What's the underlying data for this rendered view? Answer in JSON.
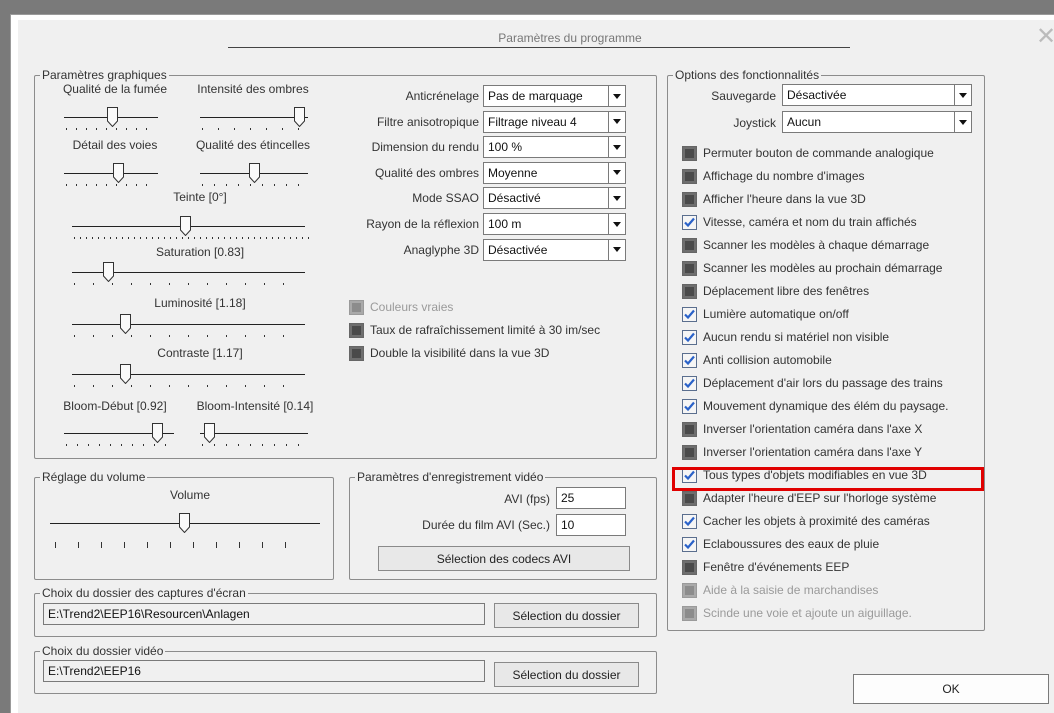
{
  "dialog": {
    "title": "Paramètres du programme"
  },
  "graphics": {
    "legend": "Paramètres graphiques",
    "sliders": {
      "smoke": "Qualité de la fumée",
      "shadows": "Intensité des ombres",
      "track_detail": "Détail des voies",
      "sparks": "Qualité des étincelles",
      "tint": "Teinte [0°]",
      "saturation": "Saturation [0.83]",
      "luminosity": "Luminosité [1.18]",
      "contrast": "Contraste [1.17]",
      "bloom_start": "Bloom-Début [0.92]",
      "bloom_intensity": "Bloom-Intensité [0.14]"
    },
    "combos": [
      {
        "label": "Anticrénelage",
        "value": "Pas de marquage"
      },
      {
        "label": "Filtre anisotropique",
        "value": "Filtrage niveau 4"
      },
      {
        "label": "Dimension du rendu",
        "value": "100 %"
      },
      {
        "label": "Qualité des ombres",
        "value": "Moyenne"
      },
      {
        "label": "Mode SSAO",
        "value": "Désactivé"
      },
      {
        "label": "Rayon de la réflexion",
        "value": "100 m"
      },
      {
        "label": "Anaglyphe 3D",
        "value": "Désactivée"
      }
    ],
    "checks": [
      {
        "label": "Couleurs vraies",
        "state": "disabled"
      },
      {
        "label": "Taux de rafraîchissement limité à 30 im/sec",
        "state": "off"
      },
      {
        "label": "Double la visibilité dans la vue 3D",
        "state": "off"
      }
    ]
  },
  "volume": {
    "legend": "Réglage du volume",
    "label": "Volume"
  },
  "video": {
    "legend": "Paramètres d'enregistrement vidéo",
    "fps_label": "AVI (fps)",
    "fps_value": "25",
    "duration_label": "Durée du film AVI (Sec.)",
    "duration_value": "10",
    "codec_button": "Sélection des codecs AVI"
  },
  "screenshot_dir": {
    "legend": "Choix du dossier des captures d'écran",
    "path": "E:\\Trend2\\EEP16\\Resourcen\\Anlagen",
    "button": "Sélection du dossier"
  },
  "video_dir": {
    "legend": "Choix du dossier vidéo",
    "path": "E:\\Trend2\\EEP16",
    "button": "Sélection du dossier"
  },
  "features": {
    "legend": "Options des fonctionnalités",
    "backup_label": "Sauvegarde",
    "backup_value": "Désactivée",
    "joystick_label": "Joystick",
    "joystick_value": "Aucun",
    "checks": [
      {
        "label": "Permuter bouton de commande analogique",
        "state": "off"
      },
      {
        "label": "Affichage du nombre d'images",
        "state": "off"
      },
      {
        "label": "Afficher l'heure dans la vue 3D",
        "state": "off"
      },
      {
        "label": "Vitesse, caméra et nom du train affichés",
        "state": "on"
      },
      {
        "label": "Scanner les modèles à chaque démarrage",
        "state": "off"
      },
      {
        "label": "Scanner les modèles au prochain démarrage",
        "state": "off"
      },
      {
        "label": "Déplacement libre des fenêtres",
        "state": "off"
      },
      {
        "label": "Lumière automatique on/off",
        "state": "on"
      },
      {
        "label": "Aucun rendu si matériel non visible",
        "state": "on"
      },
      {
        "label": "Anti collision automobile",
        "state": "on"
      },
      {
        "label": "Déplacement d'air lors du passage des trains",
        "state": "on"
      },
      {
        "label": "Mouvement dynamique des élém du paysage.",
        "state": "on"
      },
      {
        "label": "Inverser l'orientation caméra dans l'axe X",
        "state": "off"
      },
      {
        "label": "Inverser l'orientation caméra dans l'axe Y",
        "state": "off"
      },
      {
        "label": "Tous types d'objets modifiables en vue 3D",
        "state": "on"
      },
      {
        "label": "Adapter l'heure d'EEP sur l'horloge système",
        "state": "off"
      },
      {
        "label": "Cacher les objets à proximité des caméras",
        "state": "on"
      },
      {
        "label": "Eclaboussures des eaux de pluie",
        "state": "on"
      },
      {
        "label": "Fenêtre d'événements EEP",
        "state": "off"
      },
      {
        "label": "Aide à la saisie de marchandises",
        "state": "disabled"
      },
      {
        "label": "Scinde une voie et ajoute un aiguillage.",
        "state": "disabled"
      }
    ]
  },
  "ok_button": "OK",
  "colors": {
    "highlight": "#e00000",
    "check_blue": "#2a62c9"
  }
}
